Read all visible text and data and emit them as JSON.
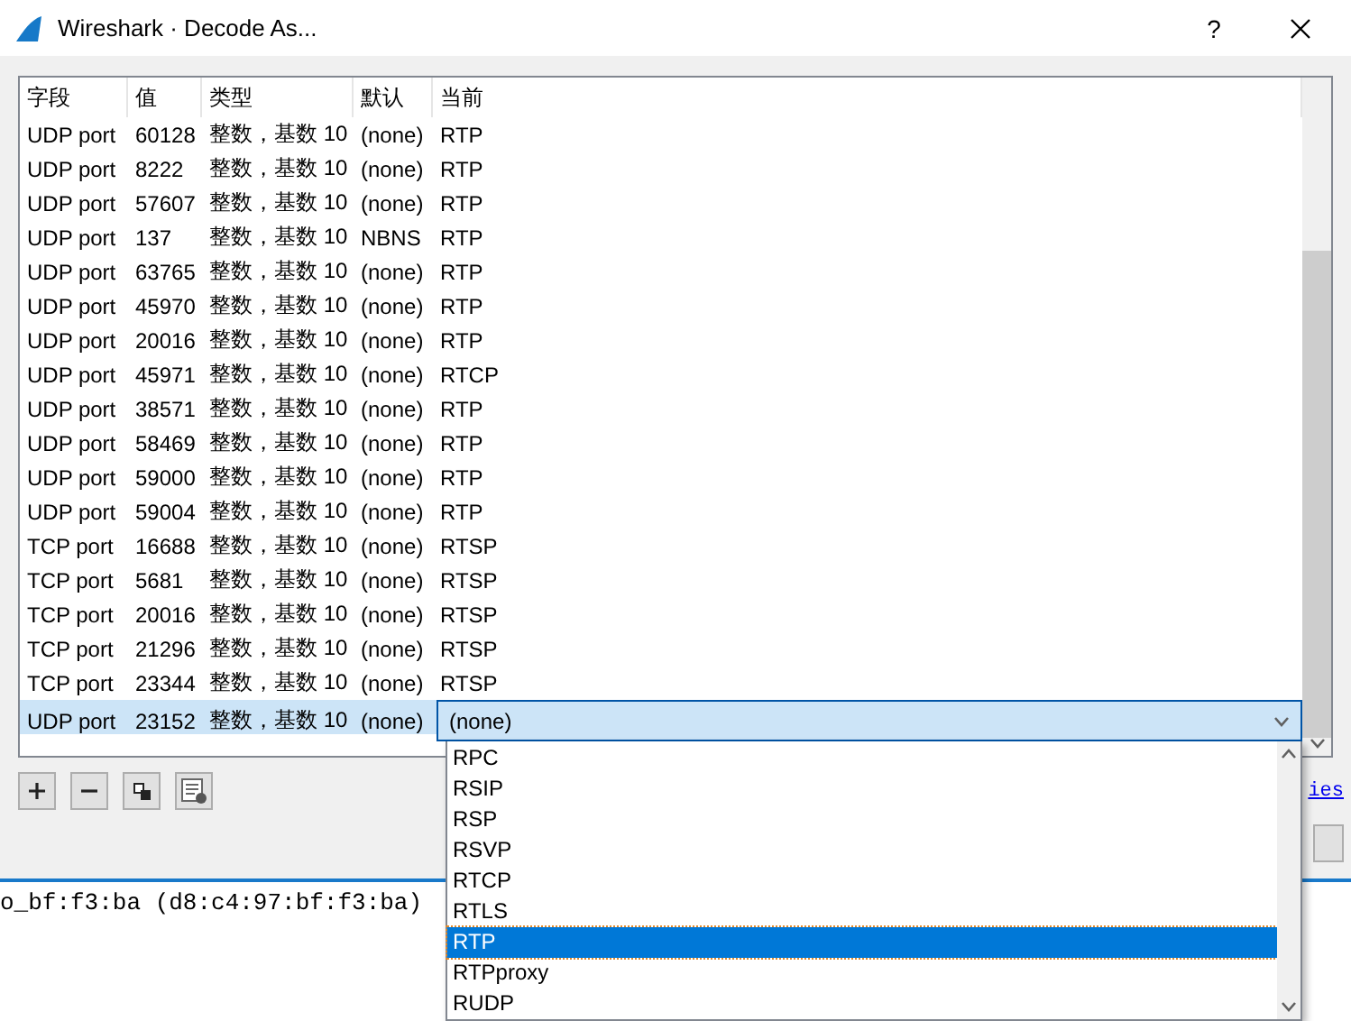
{
  "window": {
    "title": "Wireshark · Decode As...",
    "help": "?"
  },
  "table": {
    "columns": [
      "字段",
      "值",
      "类型",
      "默认",
      "当前"
    ],
    "rows": [
      {
        "field": "UDP port",
        "value": "60128",
        "type": "整数，基数 10",
        "default": "(none)",
        "current": "RTP",
        "selected": false
      },
      {
        "field": "UDP port",
        "value": "8222",
        "type": "整数，基数 10",
        "default": "(none)",
        "current": "RTP",
        "selected": false
      },
      {
        "field": "UDP port",
        "value": "57607",
        "type": "整数，基数 10",
        "default": "(none)",
        "current": "RTP",
        "selected": false
      },
      {
        "field": "UDP port",
        "value": "137",
        "type": "整数，基数 10",
        "default": "NBNS",
        "current": "RTP",
        "selected": false
      },
      {
        "field": "UDP port",
        "value": "63765",
        "type": "整数，基数 10",
        "default": "(none)",
        "current": "RTP",
        "selected": false
      },
      {
        "field": "UDP port",
        "value": "45970",
        "type": "整数，基数 10",
        "default": "(none)",
        "current": "RTP",
        "selected": false
      },
      {
        "field": "UDP port",
        "value": "20016",
        "type": "整数，基数 10",
        "default": "(none)",
        "current": "RTP",
        "selected": false
      },
      {
        "field": "UDP port",
        "value": "45971",
        "type": "整数，基数 10",
        "default": "(none)",
        "current": "RTCP",
        "selected": false
      },
      {
        "field": "UDP port",
        "value": "38571",
        "type": "整数，基数 10",
        "default": "(none)",
        "current": "RTP",
        "selected": false
      },
      {
        "field": "UDP port",
        "value": "58469",
        "type": "整数，基数 10",
        "default": "(none)",
        "current": "RTP",
        "selected": false
      },
      {
        "field": "UDP port",
        "value": "59000",
        "type": "整数，基数 10",
        "default": "(none)",
        "current": "RTP",
        "selected": false
      },
      {
        "field": "UDP port",
        "value": "59004",
        "type": "整数，基数 10",
        "default": "(none)",
        "current": "RTP",
        "selected": false
      },
      {
        "field": "TCP port",
        "value": "16688",
        "type": "整数，基数 10",
        "default": "(none)",
        "current": "RTSP",
        "selected": false
      },
      {
        "field": "TCP port",
        "value": "5681",
        "type": "整数，基数 10",
        "default": "(none)",
        "current": "RTSP",
        "selected": false
      },
      {
        "field": "TCP port",
        "value": "20016",
        "type": "整数，基数 10",
        "default": "(none)",
        "current": "RTSP",
        "selected": false
      },
      {
        "field": "TCP port",
        "value": "21296",
        "type": "整数，基数 10",
        "default": "(none)",
        "current": "RTSP",
        "selected": false
      },
      {
        "field": "TCP port",
        "value": "23344",
        "type": "整数，基数 10",
        "default": "(none)",
        "current": "RTSP",
        "selected": false
      },
      {
        "field": "UDP port",
        "value": "23152",
        "type": "整数，基数 10",
        "default": "(none)",
        "current": "(none)",
        "selected": true
      }
    ]
  },
  "dropdown": {
    "options": [
      {
        "label": "RPC",
        "selected": false
      },
      {
        "label": "RSIP",
        "selected": false
      },
      {
        "label": "RSP",
        "selected": false
      },
      {
        "label": "RSVP",
        "selected": false
      },
      {
        "label": "RTCP",
        "selected": false
      },
      {
        "label": "RTLS",
        "selected": false
      },
      {
        "label": "RTP",
        "selected": true
      },
      {
        "label": "RTPproxy",
        "selected": false
      },
      {
        "label": "RUDP",
        "selected": false
      }
    ]
  },
  "link": "ies",
  "background_text": "o_bf:f3:ba (d8:c4:97:bf:f3:ba)"
}
